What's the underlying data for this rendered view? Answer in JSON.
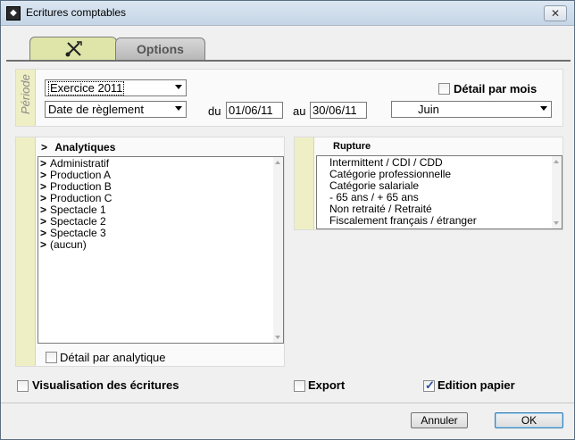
{
  "window": {
    "title": "Ecritures comptables",
    "close_label": "✕"
  },
  "tabs": [
    {
      "label": "",
      "icon": "tools-icon"
    },
    {
      "label": "Options"
    }
  ],
  "periode": {
    "label": "Période",
    "exercice": "Exercice 2011",
    "date_type": "Date de règlement",
    "du_label": "du",
    "du_value": "01/06/11",
    "au_label": "au",
    "au_value": "30/06/11",
    "month": "Juin",
    "detail_par_mois_label": "Détail par mois",
    "detail_par_mois_checked": false
  },
  "analytiques": {
    "header_marker": ">",
    "header": "Analytiques",
    "items": [
      {
        "marker": ">",
        "label": "Administratif"
      },
      {
        "marker": ">",
        "label": "Production A"
      },
      {
        "marker": ">",
        "label": "Production B"
      },
      {
        "marker": ">",
        "label": "Production C"
      },
      {
        "marker": ">",
        "label": "Spectacle 1"
      },
      {
        "marker": ">",
        "label": "Spectacle 2"
      },
      {
        "marker": ">",
        "label": "Spectacle 3"
      },
      {
        "marker": ">",
        "label": "(aucun)"
      }
    ],
    "detail_label": "Détail par analytique",
    "detail_checked": false
  },
  "rupture": {
    "header": "Rupture",
    "items": [
      "Intermittent / CDI / CDD",
      "Catégorie professionnelle",
      "Catégorie salariale",
      "- 65 ans / + 65 ans",
      "Non retraité / Retraité",
      "Fiscalement français / étranger"
    ]
  },
  "options": {
    "visualisation_label": "Visualisation des écritures",
    "visualisation_checked": false,
    "export_label": "Export",
    "export_checked": false,
    "edition_label": "Edition papier",
    "edition_checked": true
  },
  "buttons": {
    "cancel": "Annuler",
    "ok": "OK"
  }
}
